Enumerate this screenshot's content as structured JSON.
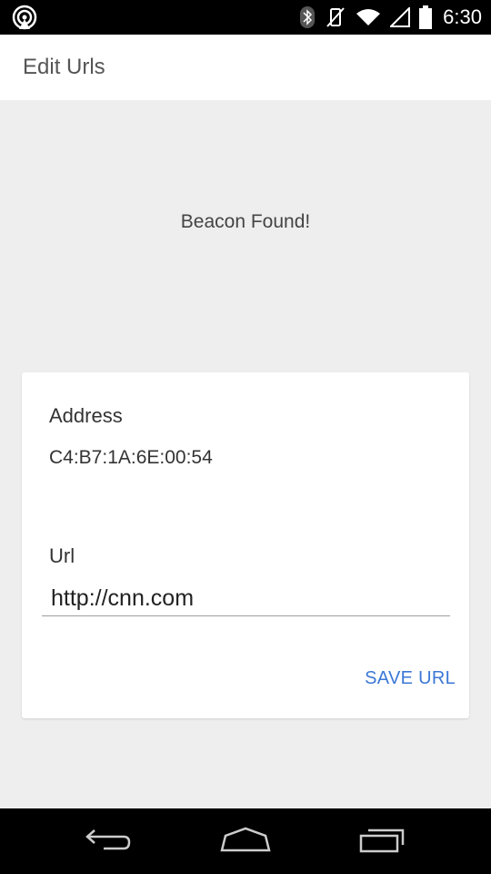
{
  "status_bar": {
    "time": "6:30",
    "icons": [
      "broadcast-icon",
      "bluetooth-icon",
      "vibrate-off-icon",
      "wifi-icon",
      "signal-icon",
      "battery-icon"
    ]
  },
  "app_bar": {
    "title": "Edit Urls"
  },
  "main": {
    "beacon_status": "Beacon Found!",
    "card": {
      "address_label": "Address",
      "address_value": "C4:B7:1A:6E:00:54",
      "url_label": "Url",
      "url_value": "http://cnn.com",
      "save_label": "SAVE URL"
    }
  },
  "nav_bar": {
    "icons": [
      "back-icon",
      "home-icon",
      "recents-icon"
    ]
  },
  "colors": {
    "accent": "#3b78d6",
    "background": "#eeeeee",
    "card": "#ffffff",
    "bars": "#000000"
  }
}
